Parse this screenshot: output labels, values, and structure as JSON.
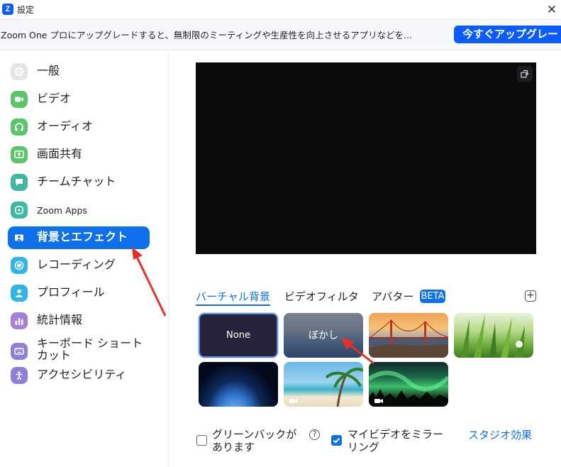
{
  "window": {
    "title": "設定",
    "app_icon_letter": "Z",
    "close_symbol": "✕"
  },
  "banner": {
    "message": "Zoom One プロにアップグレードすると、無制限のミーティングや生産性を向上させるアプリなどを...",
    "upgrade_label": "今すぐアップグレード"
  },
  "sidebar": {
    "items": [
      {
        "label": "一般",
        "icon": "gear-icon",
        "color": "#e5e5e5",
        "active": false
      },
      {
        "label": "ビデオ",
        "icon": "video-camera-icon",
        "color": "#5cc46a",
        "active": false
      },
      {
        "label": "オーディオ",
        "icon": "headphones-icon",
        "color": "#5cc46a",
        "active": false
      },
      {
        "label": "画面共有",
        "icon": "share-screen-icon",
        "color": "#5cc46a",
        "active": false
      },
      {
        "label": "チームチャット",
        "icon": "chat-icon",
        "color": "#3fb7a3",
        "active": false
      },
      {
        "label": "Zoom Apps",
        "icon": "apps-icon",
        "color": "#3fb7a3",
        "active": false
      },
      {
        "label": "背景とエフェクト",
        "icon": "background-icon",
        "color": "#0e71eb",
        "active": true
      },
      {
        "label": "レコーディング",
        "icon": "record-icon",
        "color": "#2fb5e8",
        "active": false
      },
      {
        "label": "プロフィール",
        "icon": "profile-icon",
        "color": "#2fb5e8",
        "active": false
      },
      {
        "label": "統計情報",
        "icon": "statistics-icon",
        "color": "#a87fd8",
        "active": false
      },
      {
        "label": "キーボード ショートカット",
        "icon": "keyboard-icon",
        "color": "#8f7fd8",
        "active": false
      },
      {
        "label": "アクセシビリティ",
        "icon": "accessibility-icon",
        "color": "#8f7fd8",
        "active": false
      }
    ]
  },
  "tabs": {
    "virtual_background": "バーチャル背景",
    "video_filters": "ビデオフィルタ",
    "avatars": "アバター",
    "beta_badge": "BETA"
  },
  "backgrounds": {
    "none_label": "None",
    "blur_label": "ぼかし"
  },
  "options": {
    "green_screen_label": "グリーンバックがあります",
    "green_screen_checked": false,
    "mirror_label": "マイビデオをミラーリング",
    "mirror_checked": true,
    "studio_effects_label": "スタジオ効果"
  },
  "colors": {
    "accent": "#0e71eb",
    "annotation_arrow": "#e8302a"
  }
}
